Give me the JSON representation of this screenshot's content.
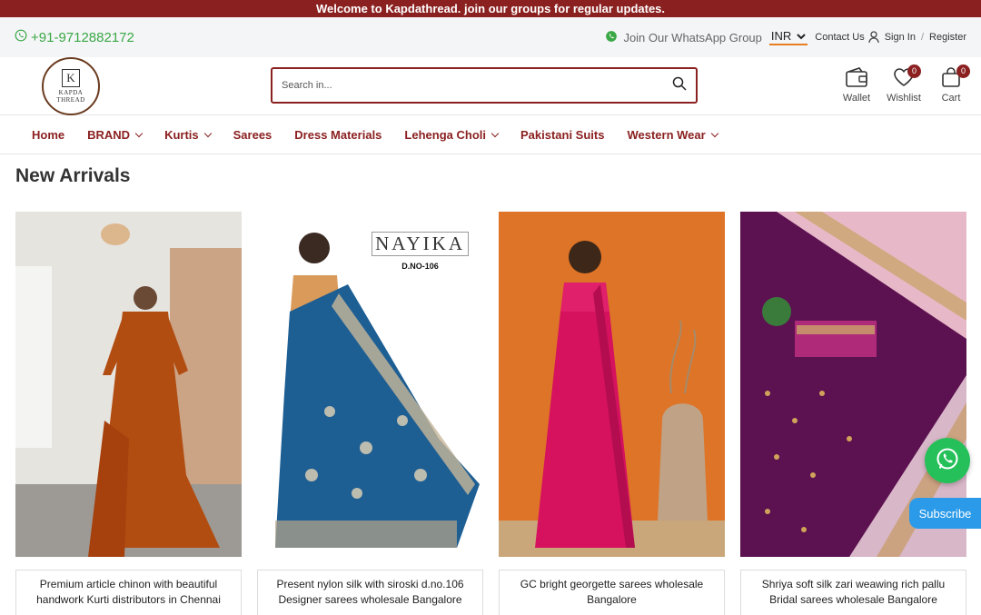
{
  "announcement": "Welcome to Kapdathread. join our groups for regular updates.",
  "topbar": {
    "phone": "+91-9712882172",
    "whatsapp_group": "Join Our WhatsApp Group",
    "currency": "INR",
    "contact": "Contact Us",
    "signin": "Sign In",
    "separator": "/",
    "register": "Register"
  },
  "logo": {
    "mark": "K",
    "line1": "KAPDA",
    "line2": "THREAD"
  },
  "search": {
    "placeholder": "Search in..."
  },
  "header_icons": {
    "wallet": "Wallet",
    "wishlist": "Wishlist",
    "wishlist_count": "0",
    "cart": "Cart",
    "cart_count": "0"
  },
  "nav": [
    {
      "label": "Home",
      "dropdown": false
    },
    {
      "label": "BRAND",
      "dropdown": true
    },
    {
      "label": "Kurtis",
      "dropdown": true
    },
    {
      "label": "Sarees",
      "dropdown": false
    },
    {
      "label": "Dress Materials",
      "dropdown": false
    },
    {
      "label": "Lehenga Choli",
      "dropdown": true
    },
    {
      "label": "Pakistani Suits",
      "dropdown": false
    },
    {
      "label": "Western Wear",
      "dropdown": true
    }
  ],
  "section_title": "New Arrivals",
  "products": [
    {
      "title": "Premium article chinon with beautiful handwork Kurti distributors in Chennai"
    },
    {
      "title": "Present nylon silk with siroski d.no.106 Designer sarees wholesale Bangalore",
      "brand": "NAYIKA",
      "design_no": "D.NO-106"
    },
    {
      "title": "GC bright georgette sarees wholesale Bangalore"
    },
    {
      "title": "Shriya soft silk zari weawing rich pallu Bridal sarees wholesale Bangalore"
    }
  ],
  "floating": {
    "subscribe": "Subscribe"
  },
  "colors": {
    "brand": "#8b2020",
    "whatsapp": "#25c05a",
    "subscribe": "#2b9ae8",
    "phone": "#3aa845"
  }
}
